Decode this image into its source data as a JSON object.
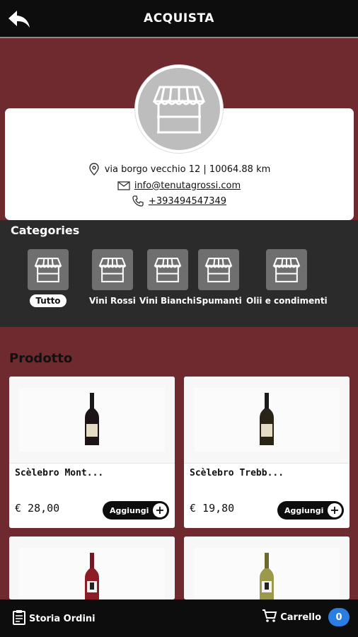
{
  "header": {
    "title": "ACQUISTA",
    "back_icon": "back-arrow-icon"
  },
  "shop": {
    "address": "via borgo vecchio 12 | 10064.88 km",
    "email": "info@tenutagrossi.com",
    "phone": "+393494547349",
    "avatar_icon": "shop-stall-icon"
  },
  "categories": {
    "title": "Categories",
    "items": [
      {
        "label": "Tutto",
        "active": true
      },
      {
        "label": "Vini Rossi"
      },
      {
        "label": "Vini Bianchi"
      },
      {
        "label": "Spumanti"
      },
      {
        "label": "Olii e condimenti"
      }
    ]
  },
  "products_section": {
    "title": "Prodotto"
  },
  "products": [
    {
      "name": "Scèlebro Mont...",
      "price": "€ 28,00",
      "add_label": "Aggiungi"
    },
    {
      "name": "Scèlebro Trebb...",
      "price": "€ 19,80",
      "add_label": "Aggiungi"
    },
    {
      "name": "",
      "price": "",
      "add_label": ""
    },
    {
      "name": "",
      "price": "",
      "add_label": ""
    }
  ],
  "bottom_bar": {
    "orders_label": "Storia Ordini",
    "cart_label": "Carrello",
    "cart_count": "0"
  },
  "colors": {
    "background": "#6e2a2e",
    "header": "#0d0d0d",
    "categories_bg": "#2a2b2a",
    "badge": "#2a7de1"
  }
}
